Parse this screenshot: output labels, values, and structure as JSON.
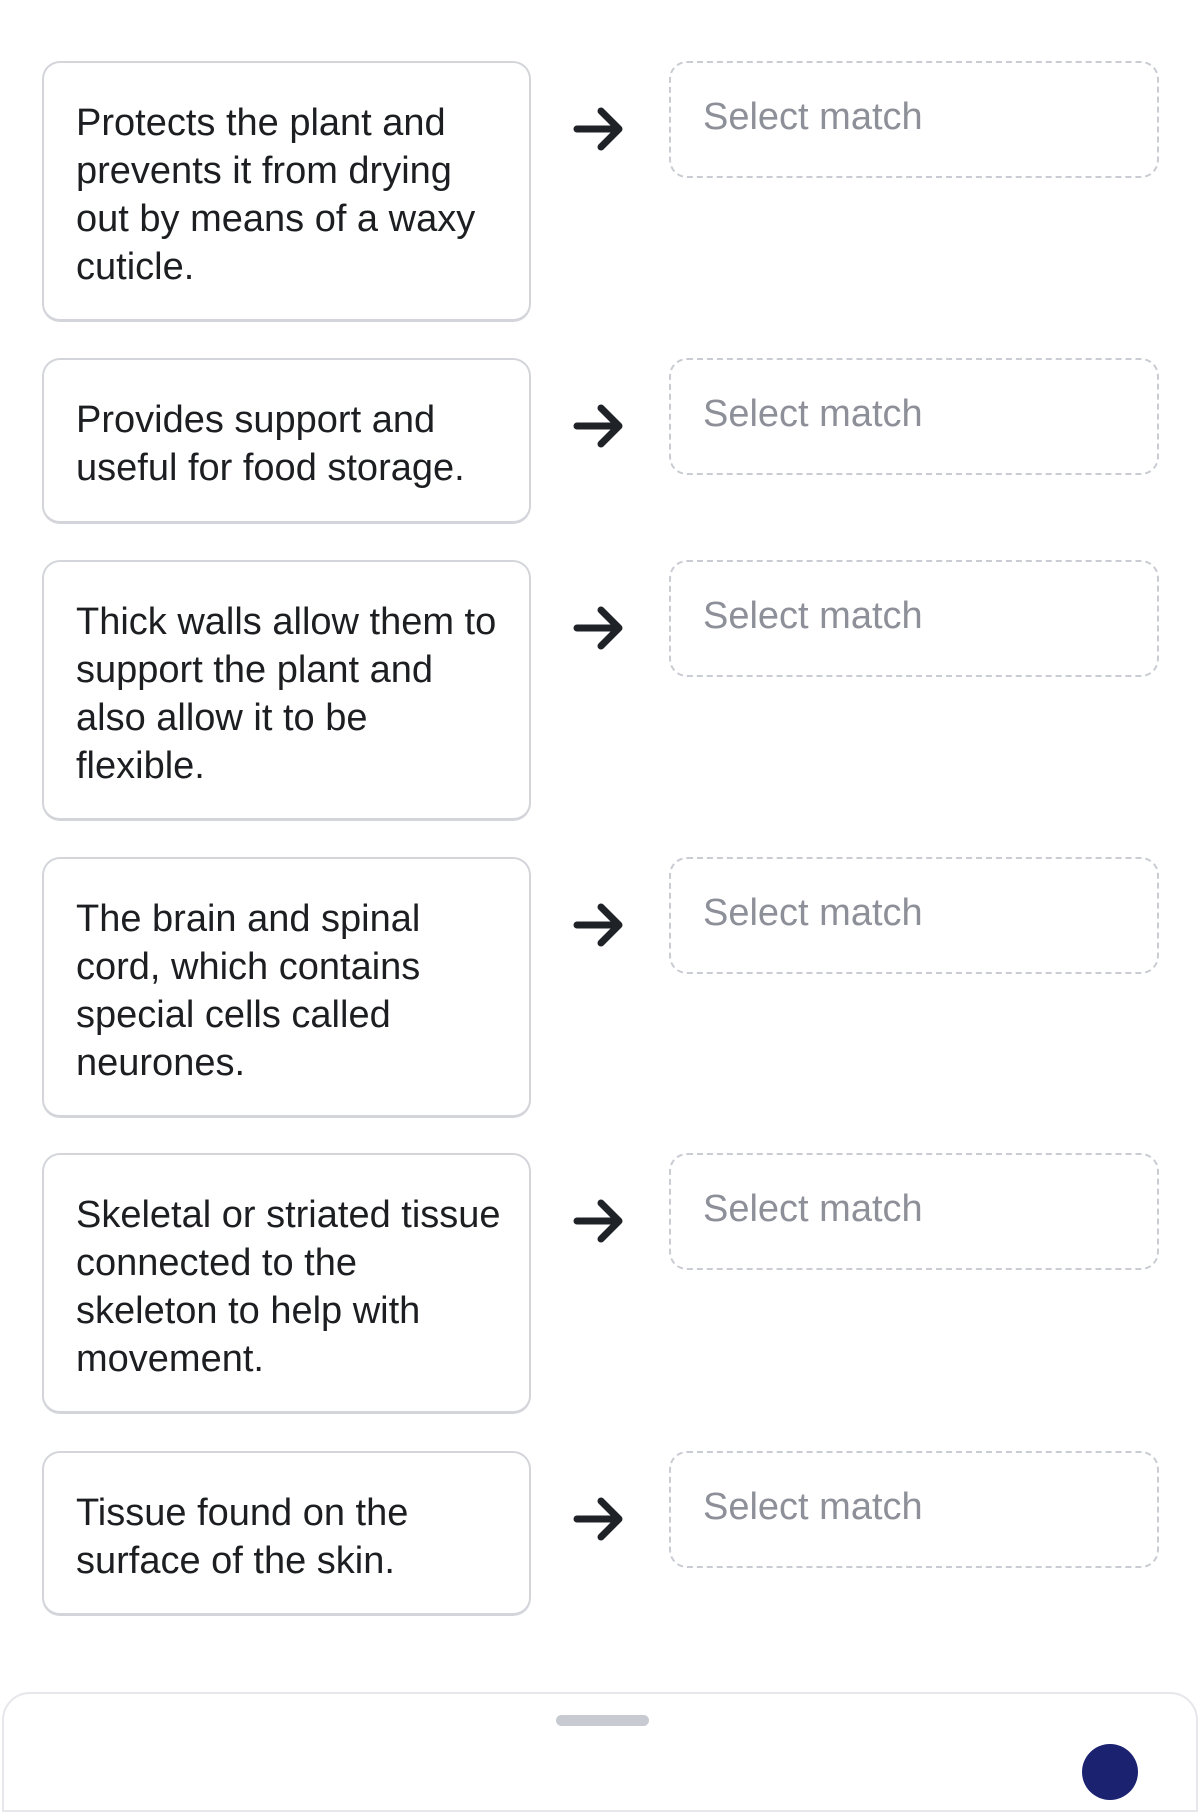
{
  "items": [
    {
      "description": "Protects the plant and prevents it from drying out by means of a waxy cuticle.",
      "match_placeholder": "Select match"
    },
    {
      "description": "Provides support and useful for food storage.",
      "match_placeholder": "Select match"
    },
    {
      "description": "Thick walls allow them to support the plant and also allow it to be flexible.",
      "match_placeholder": "Select match"
    },
    {
      "description": "The brain and spinal cord, which contains special cells called neurones.",
      "match_placeholder": "Select match"
    },
    {
      "description": "Skeletal or striated tissue connected to the skeleton to help with movement.",
      "match_placeholder": "Select match"
    },
    {
      "description": "Tissue found on the surface of the skin.",
      "match_placeholder": "Select match"
    }
  ],
  "icons": {
    "connector": "arrow-right-icon"
  },
  "colors": {
    "text": "#1c1e21",
    "placeholder": "#8d9098",
    "border": "#d3d5da",
    "accent": "#1b2270"
  }
}
